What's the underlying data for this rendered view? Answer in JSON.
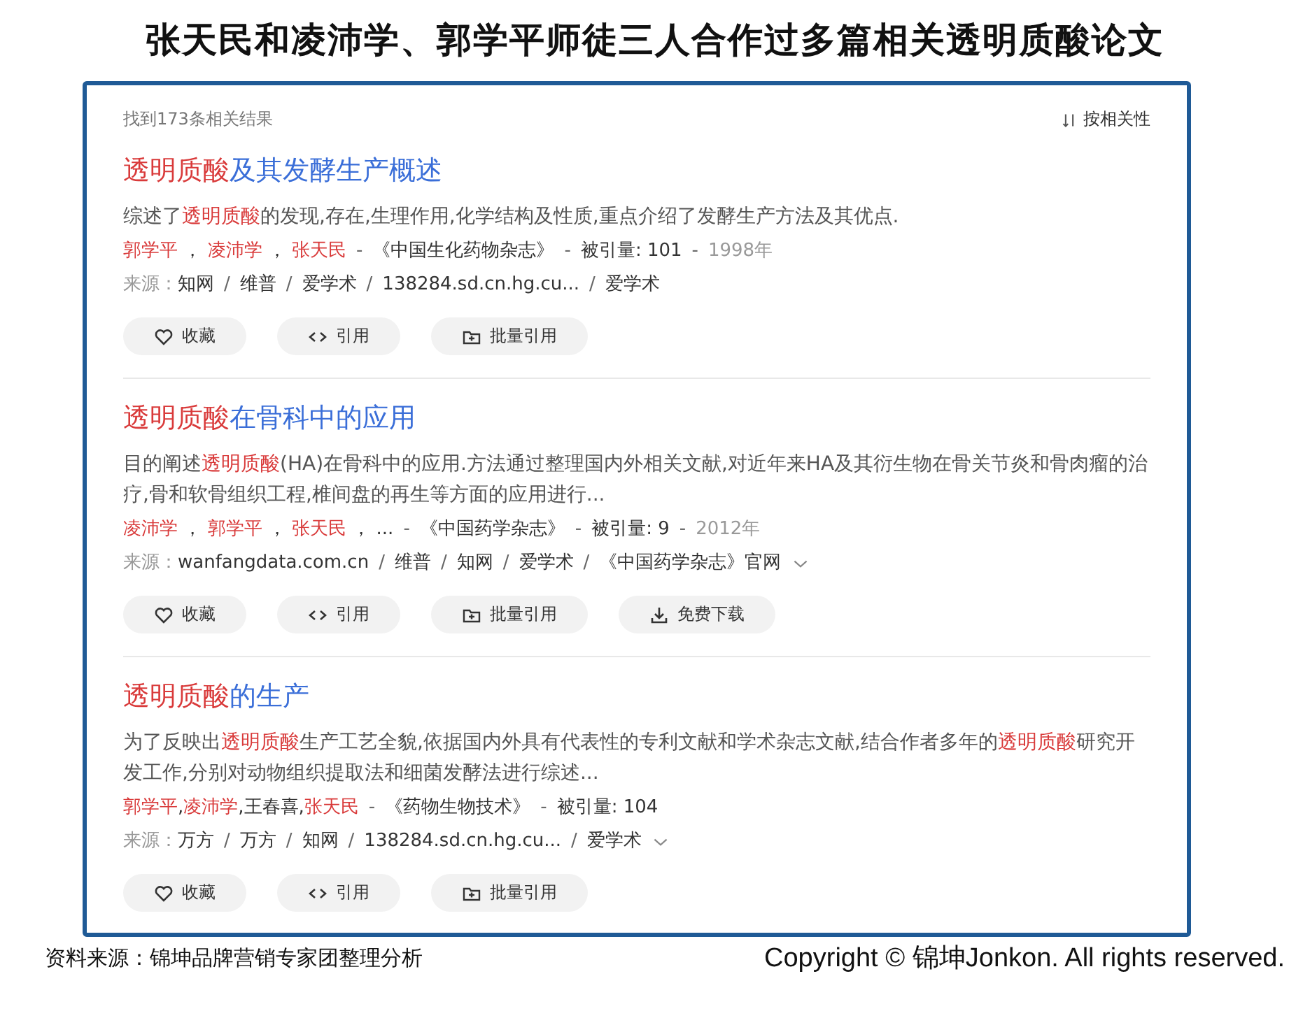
{
  "slide_title": "张天民和凌沛学、郭学平师徒三人合作过多篇相关透明质酸论文",
  "result_count": "找到173条相关结果",
  "sort": {
    "label": "按相关性"
  },
  "meta_separator": "-",
  "source_separator": "/",
  "results": [
    {
      "title": [
        {
          "text": "透明质酸",
          "hl": true
        },
        {
          "text": "及其发酵生产概述",
          "hl": false
        }
      ],
      "snippet": [
        {
          "text": "综述了",
          "hl": false
        },
        {
          "text": "透明质酸",
          "hl": true
        },
        {
          "text": "的发现,存在,生理作用,化学结构及性质,重点介绍了发酵生产方法及其优点.",
          "hl": false
        }
      ],
      "authors": [
        {
          "name": "郭学平",
          "hl": true
        },
        {
          "name": "凌沛学",
          "hl": true
        },
        {
          "name": "张天民",
          "hl": true
        }
      ],
      "author_separator": " ， ",
      "journal": "《中国生化药物杂志》",
      "citations_label": "被引量:",
      "citations": "101",
      "year": "1998年",
      "source_label": "来源：",
      "sources": [
        "知网",
        "维普",
        "爱学术",
        "138284.sd.cn.hg.cu...",
        "爱学术"
      ],
      "expandable": false,
      "actions": [
        {
          "label": "收藏",
          "kind": "heart"
        },
        {
          "label": "引用",
          "kind": "code"
        },
        {
          "label": "批量引用",
          "kind": "folder"
        }
      ]
    },
    {
      "title": [
        {
          "text": "透明质酸",
          "hl": true
        },
        {
          "text": "在骨科中的应用",
          "hl": false
        }
      ],
      "snippet": [
        {
          "text": "目的阐述",
          "hl": false
        },
        {
          "text": "透明质酸",
          "hl": true
        },
        {
          "text": "(HA)在骨科中的应用.方法通过整理国内外相关文献,对近年来HA及其衍生物在骨关节炎和骨肉瘤的治疗,骨和软骨组织工程,椎间盘的再生等方面的应用进行...",
          "hl": false
        }
      ],
      "authors": [
        {
          "name": "凌沛学",
          "hl": true
        },
        {
          "name": "郭学平",
          "hl": true
        },
        {
          "name": "张天民",
          "hl": true
        },
        {
          "name": "...",
          "hl": false
        }
      ],
      "author_separator": " ， ",
      "journal": "《中国药学杂志》",
      "citations_label": "被引量:",
      "citations": "9",
      "year": "2012年",
      "source_label": "来源：",
      "sources": [
        "wanfangdata.com.cn",
        "维普",
        "知网",
        "爱学术",
        "《中国药学杂志》官网"
      ],
      "expandable": true,
      "actions": [
        {
          "label": "收藏",
          "kind": "heart"
        },
        {
          "label": "引用",
          "kind": "code"
        },
        {
          "label": "批量引用",
          "kind": "folder"
        },
        {
          "label": "免费下载",
          "kind": "download"
        }
      ]
    },
    {
      "title": [
        {
          "text": "透明质酸",
          "hl": true
        },
        {
          "text": "的生产",
          "hl": false
        }
      ],
      "snippet": [
        {
          "text": "为了反映出",
          "hl": false
        },
        {
          "text": "透明质酸",
          "hl": true
        },
        {
          "text": "生产工艺全貌,依据国内外具有代表性的专利文献和学术杂志文献,结合作者多年的",
          "hl": false
        },
        {
          "text": "透明质酸",
          "hl": true
        },
        {
          "text": "研究开发工作,分别对动物组织提取法和细菌发酵法进行综述...",
          "hl": false
        }
      ],
      "authors": [
        {
          "name": "郭学平",
          "hl": true
        },
        {
          "name": "凌沛学",
          "hl": true
        },
        {
          "name": "王春喜",
          "hl": false
        },
        {
          "name": "张天民",
          "hl": true
        }
      ],
      "author_separator": ",",
      "journal": "《药物生物技术》",
      "citations_label": "被引量:",
      "citations": "104",
      "source_label": "来源：",
      "sources": [
        "万方",
        "万方",
        "知网",
        "138284.sd.cn.hg.cu...",
        "爱学术"
      ],
      "expandable": true,
      "actions": [
        {
          "label": "收藏",
          "kind": "heart"
        },
        {
          "label": "引用",
          "kind": "code"
        },
        {
          "label": "批量引用",
          "kind": "folder"
        }
      ]
    }
  ],
  "footer": {
    "source_note": "资料来源：锦坤品牌营销专家团整理分析",
    "copyright": "Copyright © 锦坤Jonkon. All rights reserved."
  }
}
